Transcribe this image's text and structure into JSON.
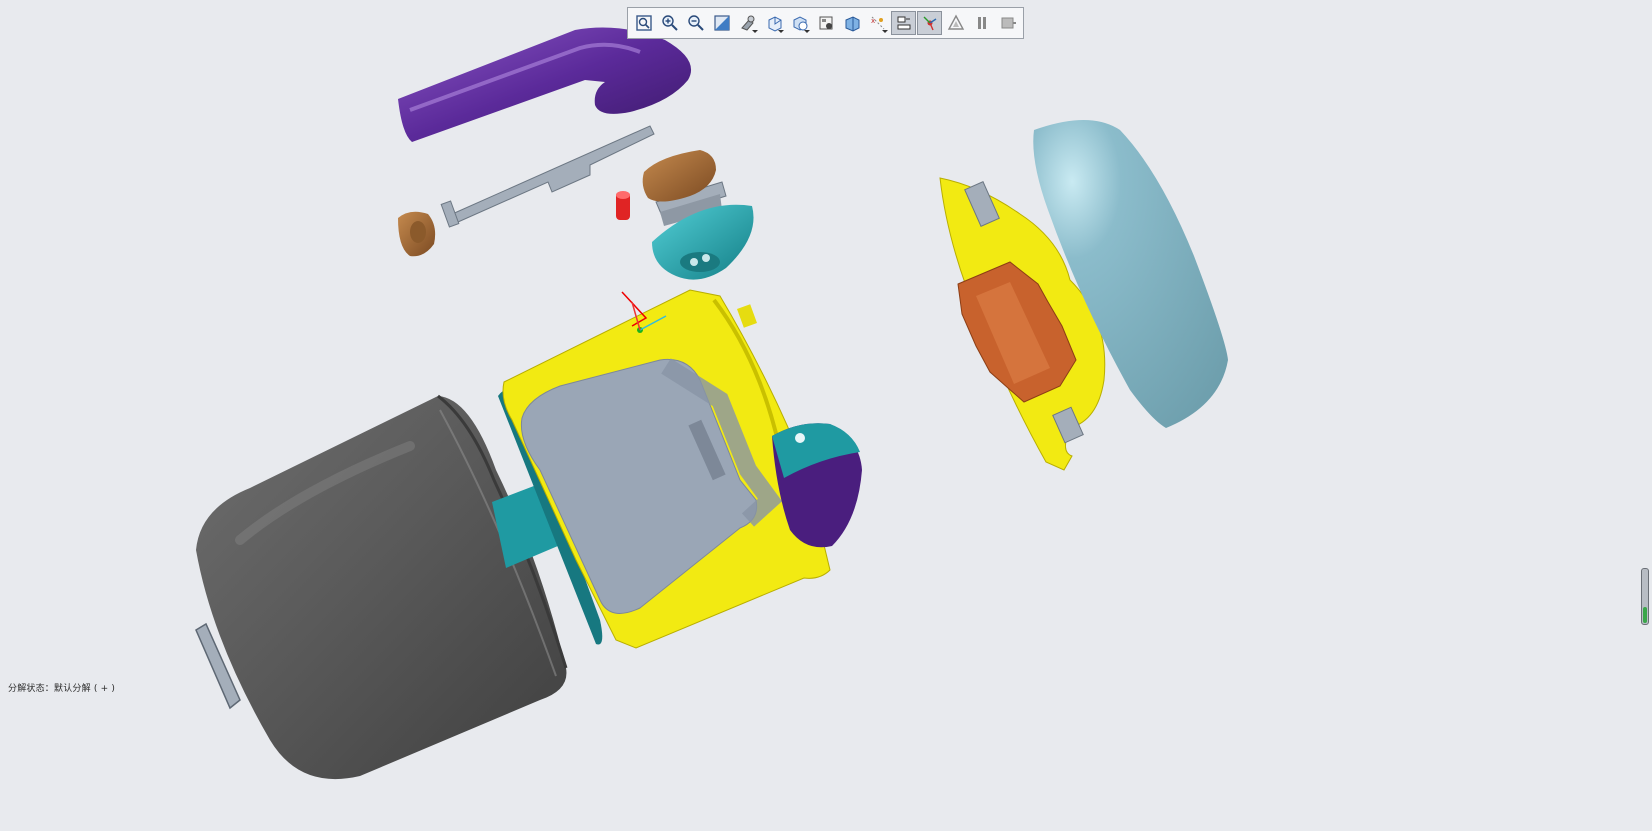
{
  "viewer": {
    "status_text": "分解状态：默认分解 ( + )",
    "scroll_level": 0.3
  },
  "toolbar": {
    "buttons": [
      {
        "icon": "zoom-fit-icon",
        "active": false,
        "dropdown": false
      },
      {
        "icon": "zoom-in-icon",
        "active": false,
        "dropdown": false
      },
      {
        "icon": "zoom-out-icon",
        "active": false,
        "dropdown": false
      },
      {
        "icon": "repaint-icon",
        "active": false,
        "dropdown": false
      },
      {
        "icon": "display-style-icon",
        "active": false,
        "dropdown": true
      },
      {
        "icon": "saved-orientations-icon",
        "active": false,
        "dropdown": true
      },
      {
        "icon": "view-manager-icon",
        "active": false,
        "dropdown": true
      },
      {
        "icon": "appearance-gallery-icon",
        "active": false,
        "dropdown": false
      },
      {
        "icon": "perspective-view-icon",
        "active": false,
        "dropdown": false
      },
      {
        "icon": "datum-display-icon",
        "active": false,
        "dropdown": true
      },
      {
        "icon": "annotation-display-icon",
        "active": true,
        "dropdown": false
      },
      {
        "icon": "spin-center-icon",
        "active": true,
        "dropdown": false
      },
      {
        "icon": "simplified-rep-icon",
        "active": false,
        "dropdown": false
      },
      {
        "icon": "pause-icon",
        "active": false,
        "dropdown": false
      },
      {
        "icon": "exit-icon",
        "active": false,
        "dropdown": false
      }
    ]
  },
  "colors": {
    "background": "#e8eaee",
    "purple_stem": "#5b2a9a",
    "yellow_frame": "#f2ea12",
    "gray_case": "#5e5e5e",
    "light_blue_cover": "#86b4c2",
    "teal_parts": "#1f9aa2",
    "orange_board": "#c8622d",
    "bronze_parts": "#a86a36",
    "steel_gray": "#a4aeba",
    "red_part": "#e02424"
  }
}
